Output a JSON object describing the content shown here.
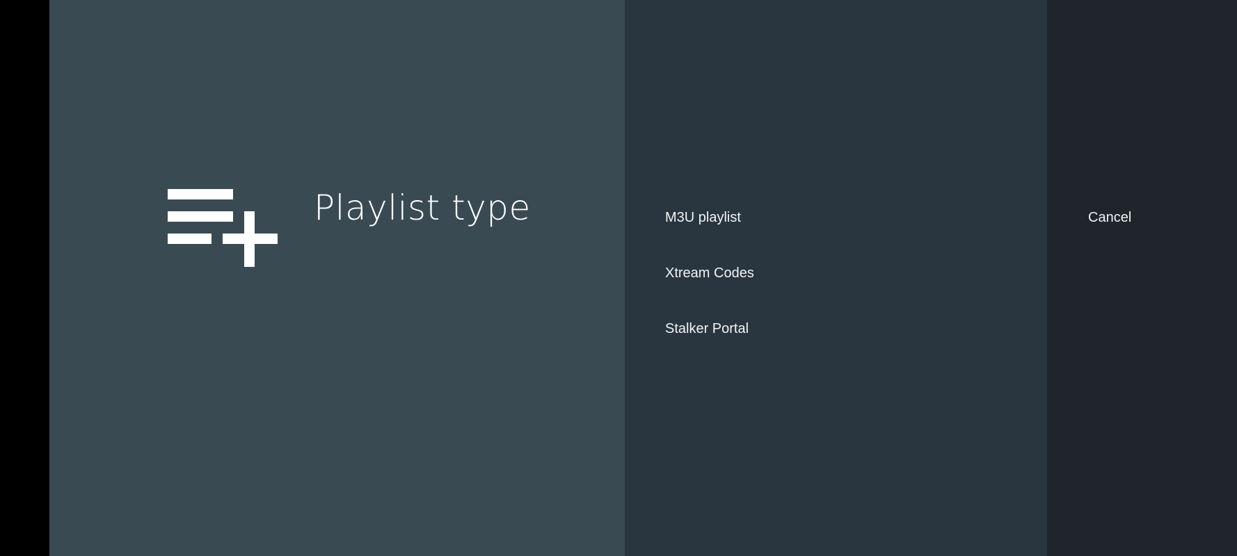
{
  "guidance": {
    "icon": "playlist-add-icon",
    "title": "Playlist type"
  },
  "actions": {
    "items": [
      {
        "label": "M3U playlist"
      },
      {
        "label": "Xtream Codes"
      },
      {
        "label": "Stalker Portal"
      }
    ]
  },
  "secondary_actions": {
    "cancel_label": "Cancel"
  },
  "colors": {
    "guidance_background": "#394a53",
    "actions_background": "#29363f",
    "secondary_background": "#1f252b",
    "text": "#ffffff"
  }
}
